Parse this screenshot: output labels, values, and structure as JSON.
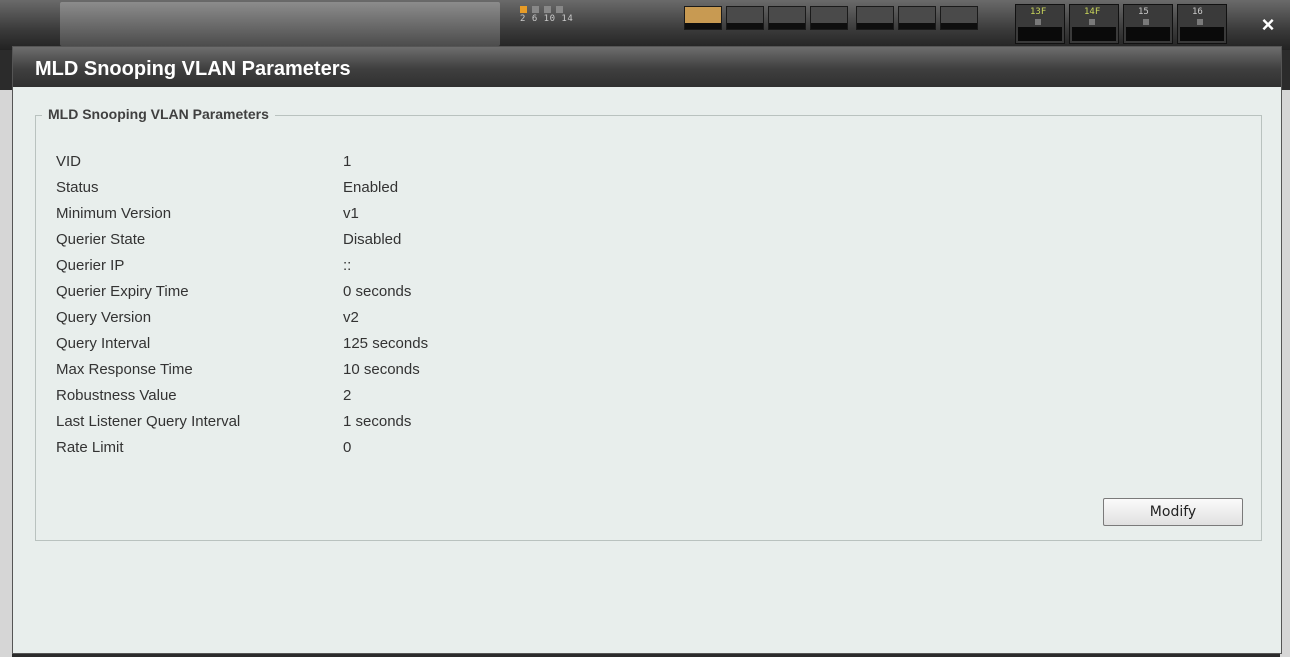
{
  "device_panel": {
    "port_numbers_top": "2  6  10 14",
    "sfp_ports": [
      {
        "label": "13F",
        "color": "#c8d45a"
      },
      {
        "label": "14F",
        "color": "#c8d45a"
      },
      {
        "label": "15",
        "color": "#c9c9c9"
      },
      {
        "label": "16",
        "color": "#c9c9c9"
      }
    ],
    "close_glyph": "×"
  },
  "dialog": {
    "title": "MLD Snooping VLAN Parameters",
    "section_legend": "MLD Snooping VLAN Parameters",
    "params": [
      {
        "label": "VID",
        "value": "1"
      },
      {
        "label": "Status",
        "value": "Enabled"
      },
      {
        "label": "Minimum Version",
        "value": "v1"
      },
      {
        "label": "Querier State",
        "value": "Disabled"
      },
      {
        "label": "Querier IP",
        "value": "::"
      },
      {
        "label": "Querier Expiry Time",
        "value": "0 seconds"
      },
      {
        "label": "Query Version",
        "value": "v2"
      },
      {
        "label": "Query Interval",
        "value": "125 seconds"
      },
      {
        "label": "Max Response Time",
        "value": "10 seconds"
      },
      {
        "label": "Robustness Value",
        "value": "2"
      },
      {
        "label": "Last Listener Query Interval",
        "value": "1 seconds"
      },
      {
        "label": "Rate Limit",
        "value": "0"
      }
    ],
    "modify_label": "Modify"
  },
  "colors": {
    "dialog_background": "#e8eeec",
    "title_bar": "#3f3f3f",
    "port_led_active": "#e79c27"
  }
}
